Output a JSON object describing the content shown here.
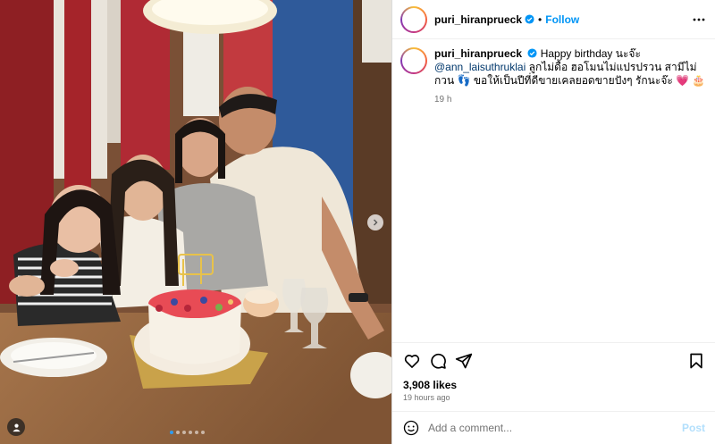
{
  "post": {
    "username": "puri_hiranprueck",
    "follow_label": "Follow",
    "separator": "•",
    "caption": {
      "username": "puri_hiranprueck",
      "text_before": "Happy birthday นะจ๊ะ ",
      "mention": "@ann_laisuthruklai",
      "text_after": " ลูกไม่ดื้อ ฮอโมนไม่แปรปรวน สามีไม่กวน 👣 ขอให้เป็นปีที่ดีขายเคลยอดขายปังๆ รักนะจ๊ะ 💗 🎂",
      "time": "19 h"
    },
    "likes": "3,908 likes",
    "posted_ago": "19 hours ago",
    "comment": {
      "placeholder": "Add a comment...",
      "post_label": "Post"
    },
    "carousel": {
      "slide_count": 6,
      "active_index": 0
    }
  },
  "icons": {
    "header_more": "more-horizontal-icon",
    "verified": "verified-badge-icon",
    "like": "heart-icon",
    "comment": "comment-icon",
    "share": "send-icon",
    "save": "bookmark-icon",
    "emoji": "emoji-icon",
    "next": "chevron-right-icon",
    "tagged": "user-tag-icon"
  },
  "colors": {
    "accent": "#0095f6",
    "mention": "#00376b",
    "muted": "#737373",
    "post_disabled": "#b2dffc"
  }
}
